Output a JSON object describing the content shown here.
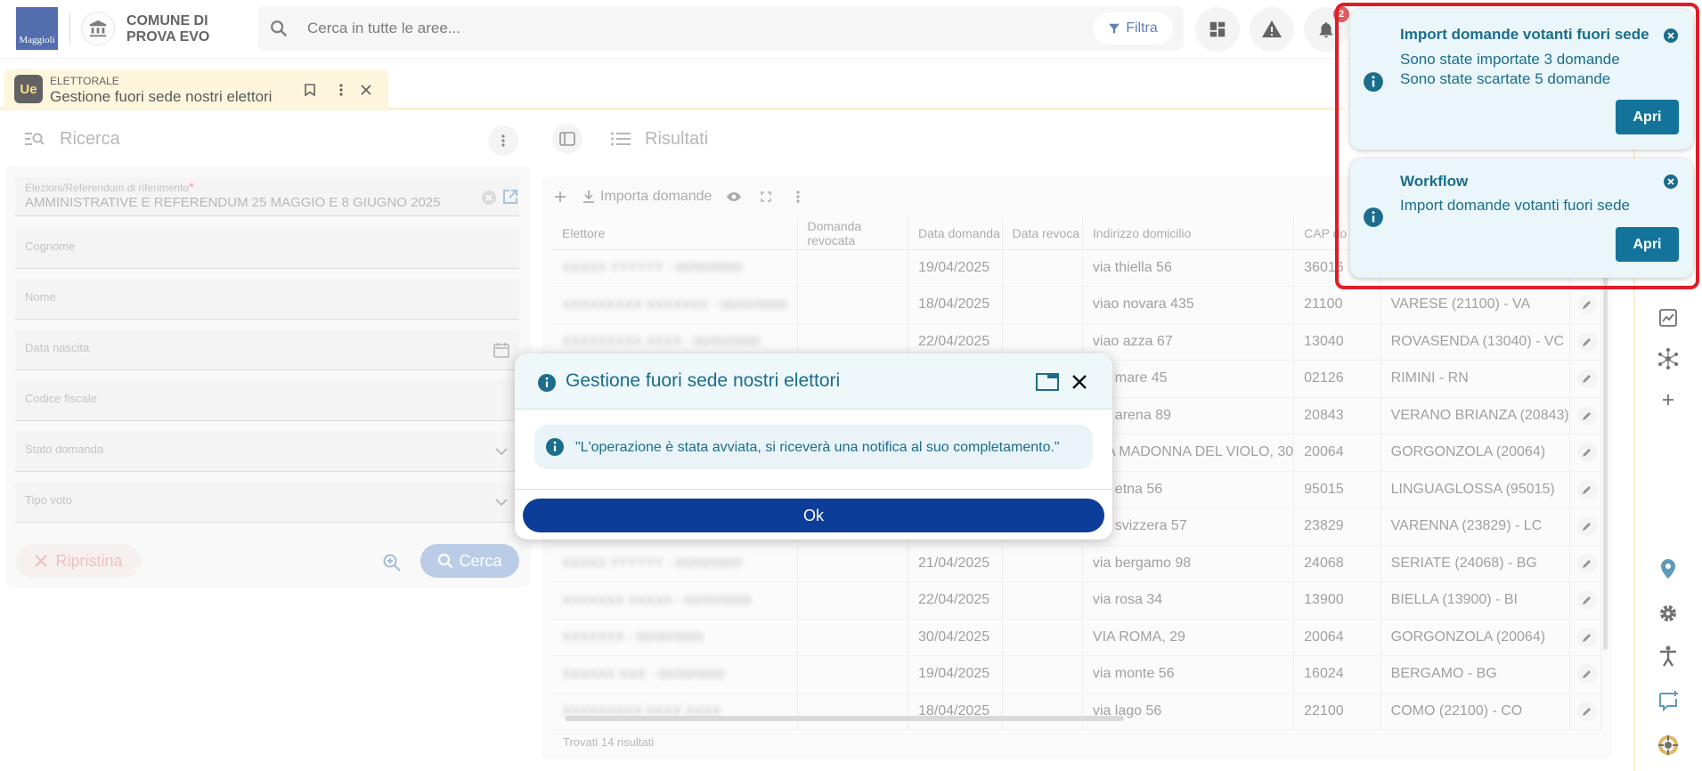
{
  "header": {
    "logo_text": "Maggioli",
    "municipality_line1": "COMUNE DI",
    "municipality_line2": "PROVA EVO",
    "search_placeholder": "Cerca in tutte le aree...",
    "filter_label": "Filtra",
    "notification_count": "2"
  },
  "tab": {
    "icon_text": "Ue",
    "module": "ELETTORALE",
    "title": "Gestione fuori sede nostri elettori"
  },
  "search_panel": {
    "title": "Ricerca",
    "fields": {
      "election_label": "Elezioni/Referendum di riferimento",
      "election_required": "*",
      "election_value": "AMMINISTRATIVE E REFERENDUM 25 MAGGIO E 8 GIUGNO 2025",
      "surname": "Cognome",
      "name": "Nome",
      "birth_date": "Data nascita",
      "tax_code": "Codice fiscale",
      "status": "Stato domanda",
      "vote_type": "Tipo voto"
    },
    "reset_label": "Ripristina",
    "search_label": "Cerca"
  },
  "results_panel": {
    "title": "Risultati",
    "import_label": "Importa domande",
    "columns": [
      "Elettore",
      "Domanda revocata",
      "Data domanda",
      "Data revoca",
      "Indirizzo domicilio",
      "CAP do",
      ""
    ],
    "rows": [
      {
        "elettore": "XXXXX YYYYYY - 00/00/0000",
        "data": "19/04/2025",
        "indirizzo": "via thiella 56",
        "cap": "36016",
        "comune": ""
      },
      {
        "elettore": "XXXXXXXXX XXXXXXX - 00/00/0000",
        "data": "18/04/2025",
        "indirizzo": "viao novara 435",
        "cap": "21100",
        "comune": "VARESE (21100) - VA"
      },
      {
        "elettore": "XXXXXXXXX XXXX - 00/00/0000",
        "data": "22/04/2025",
        "indirizzo": "viao azza 67",
        "cap": "13040",
        "comune": "ROVASENDA (13040) - VC"
      },
      {
        "elettore": "XXXXXX XXXXX - 00/00/0000",
        "data": "",
        "indirizzo": "via mare 45",
        "cap": "02126",
        "comune": "RIMINI - RN"
      },
      {
        "elettore": "XXXXXX XXXXX - 00/00/0000",
        "data": "",
        "indirizzo": "via arena 89",
        "cap": "20843",
        "comune": "VERANO BRIANZA (20843)"
      },
      {
        "elettore": "XXXXXX XXXXX - 00/00/0000",
        "data": "",
        "indirizzo": "VIA MADONNA DEL VIOLO, 30",
        "cap": "20064",
        "comune": "GORGONZOLA (20064)"
      },
      {
        "elettore": "XXXXXX XXXXX - 00/00/0000",
        "data": "",
        "indirizzo": "via etna 56",
        "cap": "95015",
        "comune": "LINGUAGLOSSA (95015)"
      },
      {
        "elettore": "XXXXXX XXXXX - 00/00/0000",
        "data": "",
        "indirizzo": "via svizzera 57",
        "cap": "23829",
        "comune": "VARENNA (23829) - LC"
      },
      {
        "elettore": "XXXXX YYYYYY - 00/00/0000",
        "data": "21/04/2025",
        "indirizzo": "via bergamo 98",
        "cap": "24068",
        "comune": "SERIATE (24068) - BG"
      },
      {
        "elettore": "XXXXXXX XXXXX - 00/00/0000",
        "data": "22/04/2025",
        "indirizzo": "via rosa 34",
        "cap": "13900",
        "comune": "BIELLA (13900) - BI"
      },
      {
        "elettore": "XXXXXXX - 00/00/0000",
        "data": "30/04/2025",
        "indirizzo": "VIA ROMA, 29",
        "cap": "20064",
        "comune": "GORGONZOLA (20064)"
      },
      {
        "elettore": "XXXXXX XXX - 00/00/0000",
        "data": "19/04/2025",
        "indirizzo": "via monte 56",
        "cap": "16024",
        "comune": "BERGAMO - BG"
      },
      {
        "elettore": "XXXXXXXXX XXXX XXXX",
        "data": "18/04/2025",
        "indirizzo": "via lago 56",
        "cap": "22100",
        "comune": "COMO (22100) - CO"
      }
    ],
    "footer": "Trovati 14 risultati"
  },
  "modal": {
    "title": "Gestione fuori sede nostri elettori",
    "message": "\"L'operazione è stata avviata, si riceverà una notifica al suo completamento.\"",
    "ok_label": "Ok"
  },
  "notifications": [
    {
      "title": "Import domande votanti fuori sede",
      "line1": "Sono state importate 3 domande",
      "line2": "Sono state scartate 5 domande",
      "button": "Apri"
    },
    {
      "title": "Workflow",
      "line1": "Import domande votanti fuori sede",
      "button": "Apri"
    }
  ],
  "colors": {
    "brand": "#0c3d99",
    "notif_text": "#1b6d8c",
    "tab_bg": "#fdf3cd",
    "highlight": "#e01c26"
  }
}
